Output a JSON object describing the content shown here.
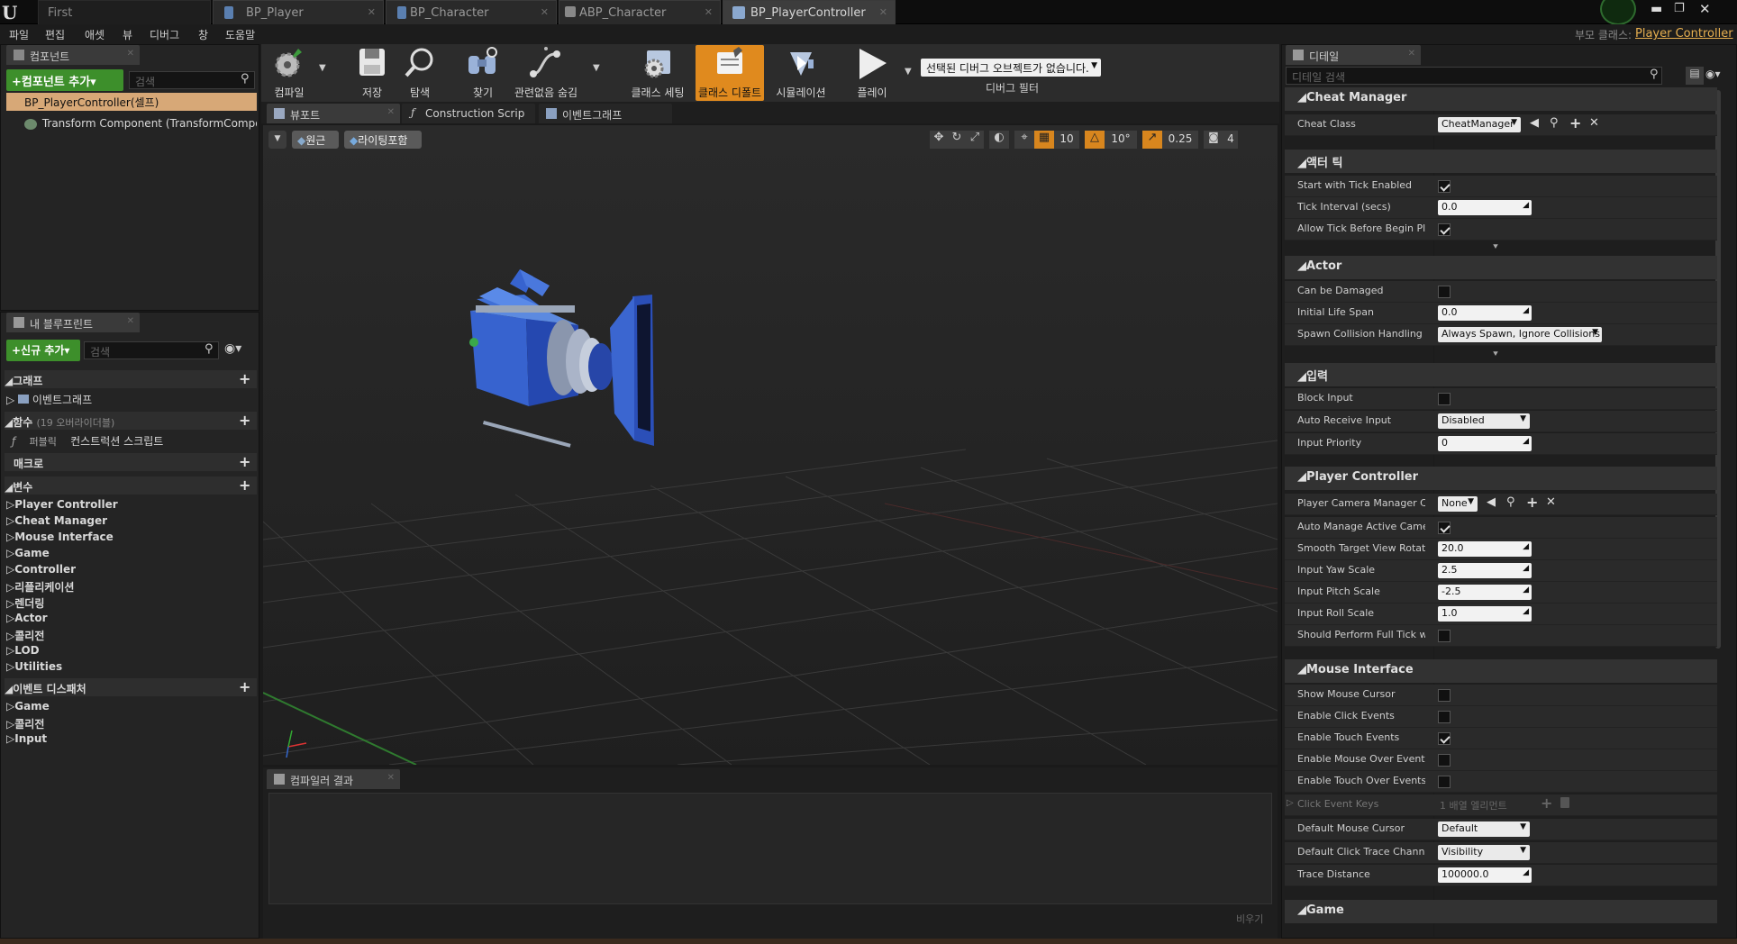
{
  "tabs": {
    "first": "First",
    "t1": "BP_Player",
    "t2": "BP_Character",
    "t3": "ABP_Character",
    "t4": "BP_PlayerController"
  },
  "title_right": {
    "user": "부모 클래스:",
    "parent": "Player Controller"
  },
  "menu": [
    "파일",
    "편집",
    "애셋",
    "뷰",
    "디버그",
    "창",
    "도움말"
  ],
  "components": {
    "tab": "컴포넌트",
    "add_button": "+컴포넌트 추가▾",
    "search_placeholder": "검색",
    "root": "BP_PlayerController(셀프)",
    "child": "Transform Component (TransformComponent)"
  },
  "myblueprint": {
    "tab": "내 블루프린트",
    "add_button": "+신규 추가▾",
    "search_placeholder": "검색",
    "graphs_header": "그래프",
    "event_graph": "이벤트그래프",
    "functions_header": "함수",
    "functions_count": "(19 오버라이더블)",
    "public_label": "퍼블릭",
    "construction": "컨스트럭션 스크립트",
    "macros_header": "매크로",
    "variables_header": "변수",
    "variables": [
      "Player Controller",
      "Cheat Manager",
      "Mouse Interface",
      "Game",
      "Controller",
      "리플리케이션",
      "렌더링",
      "Actor",
      "콜리전",
      "LOD",
      "Utilities"
    ],
    "dispatchers_header": "이벤트 디스패처",
    "dispatchers": [
      "Game",
      "콜리전",
      "Input"
    ]
  },
  "toolbar": {
    "compile": "컴파일",
    "save": "저장",
    "browse": "탐색",
    "find": "찾기",
    "hide_unrelated": "관련없음 숨김",
    "class_settings": "클래스 세팅",
    "class_defaults": "클래스 디폴트",
    "simulation": "시뮬레이션",
    "play": "플레이",
    "debug_select": "선택된 디버그 오브젝트가 없습니다.",
    "debug_filter": "디버그 필터"
  },
  "editor_tabs": {
    "viewport": "뷰포트",
    "construction": "Construction Scrip",
    "event_graph": "이벤트그래프"
  },
  "viewport": {
    "perspective": "원근",
    "lit": "라이팅포함",
    "grid": "10",
    "rot": "10°",
    "scale": "0.25",
    "cam": "4"
  },
  "compiler": {
    "tab": "컴파일러 결과",
    "clear": "비우기"
  },
  "details": {
    "tab": "디테일",
    "search_placeholder": "디테일 검색",
    "categories": {
      "cheat": "Cheat Manager",
      "tick": "액터 틱",
      "actor": "Actor",
      "input": "입력",
      "pc": "Player Controller",
      "mouse": "Mouse Interface",
      "game": "Game"
    },
    "cheat_class": {
      "label": "Cheat Class",
      "value": "CheatManager"
    },
    "start_tick": "Start with Tick Enabled",
    "tick_interval": {
      "label": "Tick Interval (secs)",
      "value": "0.0"
    },
    "allow_tick": "Allow Tick Before Begin Play",
    "can_damaged": "Can be Damaged",
    "life_span": {
      "label": "Initial Life Span",
      "value": "0.0"
    },
    "spawn": {
      "label": "Spawn Collision Handling Met",
      "value": "Always Spawn, Ignore Collisions"
    },
    "block_input": "Block Input",
    "auto_receive": {
      "label": "Auto Receive Input",
      "value": "Disabled"
    },
    "input_priority": {
      "label": "Input Priority",
      "value": "0"
    },
    "cam_manager": {
      "label": "Player Camera Manager Class",
      "value": "None"
    },
    "auto_manage": "Auto Manage Active Camera T",
    "smooth": {
      "label": "Smooth Target View Rotation",
      "value": "20.0"
    },
    "yaw": {
      "label": "Input Yaw Scale",
      "value": "2.5"
    },
    "pitch": {
      "label": "Input Pitch Scale",
      "value": "-2.5"
    },
    "roll": {
      "label": "Input Roll Scale",
      "value": "1.0"
    },
    "full_tick": "Should Perform Full Tick wher",
    "show_cursor": "Show Mouse Cursor",
    "click_events": "Enable Click Events",
    "touch_events": "Enable Touch Events",
    "mouse_over": "Enable Mouse Over Events",
    "touch_over": "Enable Touch Over Events",
    "click_keys": {
      "label": "Click Event Keys",
      "value": "1 배열 엘리먼트"
    },
    "default_cursor": {
      "label": "Default Mouse Cursor",
      "value": "Default"
    },
    "trace_channel": {
      "label": "Default Click Trace Channel",
      "value": "Visibility"
    },
    "trace_distance": {
      "label": "Trace Distance",
      "value": "100000.0"
    }
  }
}
